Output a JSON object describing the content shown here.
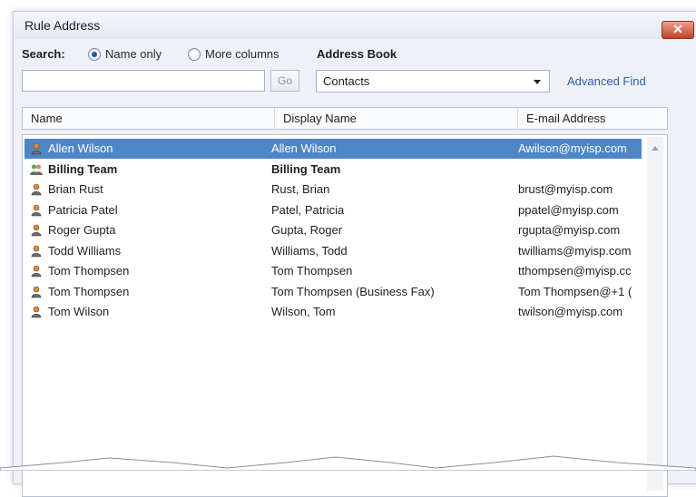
{
  "window": {
    "title": "Rule Address",
    "close_label": "✕"
  },
  "search": {
    "label": "Search:",
    "option_name_only": "Name only",
    "option_more_columns": "More columns",
    "selected": "Name only",
    "input_value": "",
    "go_label": "Go"
  },
  "address_book": {
    "label": "Address Book",
    "selected": "Contacts",
    "advanced_find": "Advanced Find"
  },
  "columns": [
    "Name",
    "Display Name",
    "E-mail Address"
  ],
  "rows": [
    {
      "name": "Allen Wilson",
      "display": "Allen Wilson",
      "email": "Awilson@myisp.com",
      "icon": "person-icon",
      "selected": true,
      "bold": false
    },
    {
      "name": "Billing Team",
      "display": "Billing Team",
      "email": "",
      "icon": "group-icon",
      "selected": false,
      "bold": true
    },
    {
      "name": "Brian Rust",
      "display": "Rust, Brian",
      "email": "brust@myisp.com",
      "icon": "person-icon",
      "selected": false,
      "bold": false
    },
    {
      "name": "Patricia Patel",
      "display": "Patel, Patricia",
      "email": "ppatel@myisp.com",
      "icon": "person-icon",
      "selected": false,
      "bold": false
    },
    {
      "name": "Roger Gupta",
      "display": "Gupta, Roger",
      "email": "rgupta@myisp.com",
      "icon": "person-icon",
      "selected": false,
      "bold": false
    },
    {
      "name": "Todd Williams",
      "display": "Williams, Todd",
      "email": "twilliams@myisp.com",
      "icon": "person-icon",
      "selected": false,
      "bold": false
    },
    {
      "name": "Tom Thompsen",
      "display": "Tom Thompsen",
      "email": "tthompsen@myisp.cc",
      "icon": "person-icon",
      "selected": false,
      "bold": false
    },
    {
      "name": "Tom Thompsen",
      "display": "Tom Thompsen (Business Fax)",
      "email": "Tom Thompsen@+1 (",
      "icon": "person-icon",
      "selected": false,
      "bold": false
    },
    {
      "name": "Tom Wilson",
      "display": "Wilson, Tom",
      "email": "twilson@myisp.com",
      "icon": "person-icon",
      "selected": false,
      "bold": false
    }
  ],
  "colors": {
    "selection": "#4f86c8",
    "link": "#2b5fb4",
    "close": "#c3422a"
  }
}
